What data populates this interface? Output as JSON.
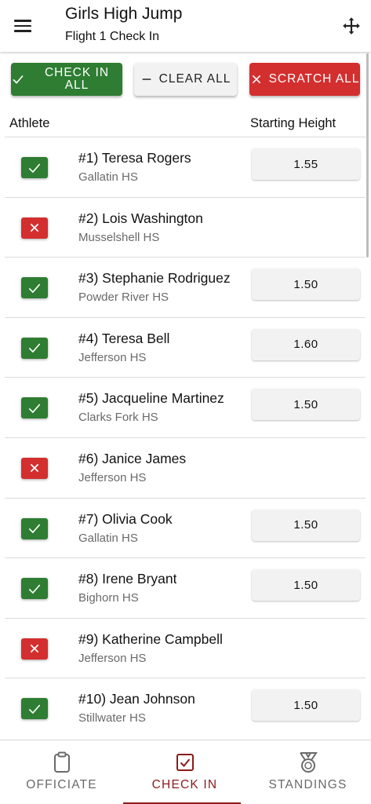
{
  "header": {
    "title": "Girls High Jump",
    "subtitle": "Flight 1 Check In"
  },
  "actions": {
    "check_in_all": "Check In All",
    "clear_all": "Clear All",
    "scratch_all": "Scratch All"
  },
  "columns": {
    "athlete": "Athlete",
    "starting_height": "Starting Height"
  },
  "athletes": [
    {
      "name": "#1) Teresa Rogers",
      "school": "Gallatin HS",
      "status": "checked-in",
      "height": "1.55"
    },
    {
      "name": "#2) Lois Washington",
      "school": "Musselshell HS",
      "status": "scratched",
      "height": ""
    },
    {
      "name": "#3) Stephanie Rodriguez",
      "school": "Powder River HS",
      "status": "checked-in",
      "height": "1.50"
    },
    {
      "name": "#4) Teresa Bell",
      "school": "Jefferson HS",
      "status": "checked-in",
      "height": "1.60"
    },
    {
      "name": "#5) Jacqueline Martinez",
      "school": "Clarks Fork HS",
      "status": "checked-in",
      "height": "1.50"
    },
    {
      "name": "#6) Janice James",
      "school": "Jefferson HS",
      "status": "scratched",
      "height": ""
    },
    {
      "name": "#7) Olivia Cook",
      "school": "Gallatin HS",
      "status": "checked-in",
      "height": "1.50"
    },
    {
      "name": "#8) Irene Bryant",
      "school": "Bighorn HS",
      "status": "checked-in",
      "height": "1.50"
    },
    {
      "name": "#9) Katherine Campbell",
      "school": "Jefferson HS",
      "status": "scratched",
      "height": ""
    },
    {
      "name": "#10) Jean Johnson",
      "school": "Stillwater HS",
      "status": "checked-in",
      "height": "1.50"
    }
  ],
  "tabs": [
    {
      "label": "Officiate",
      "icon": "clipboard-icon",
      "active": false
    },
    {
      "label": "Check In",
      "icon": "checkbox-icon",
      "active": true
    },
    {
      "label": "Standings",
      "icon": "medal-icon",
      "active": false
    }
  ],
  "colors": {
    "checked_in": "#2e7d32",
    "scratched": "#d32f2f",
    "accent": "#8b1a1a"
  }
}
